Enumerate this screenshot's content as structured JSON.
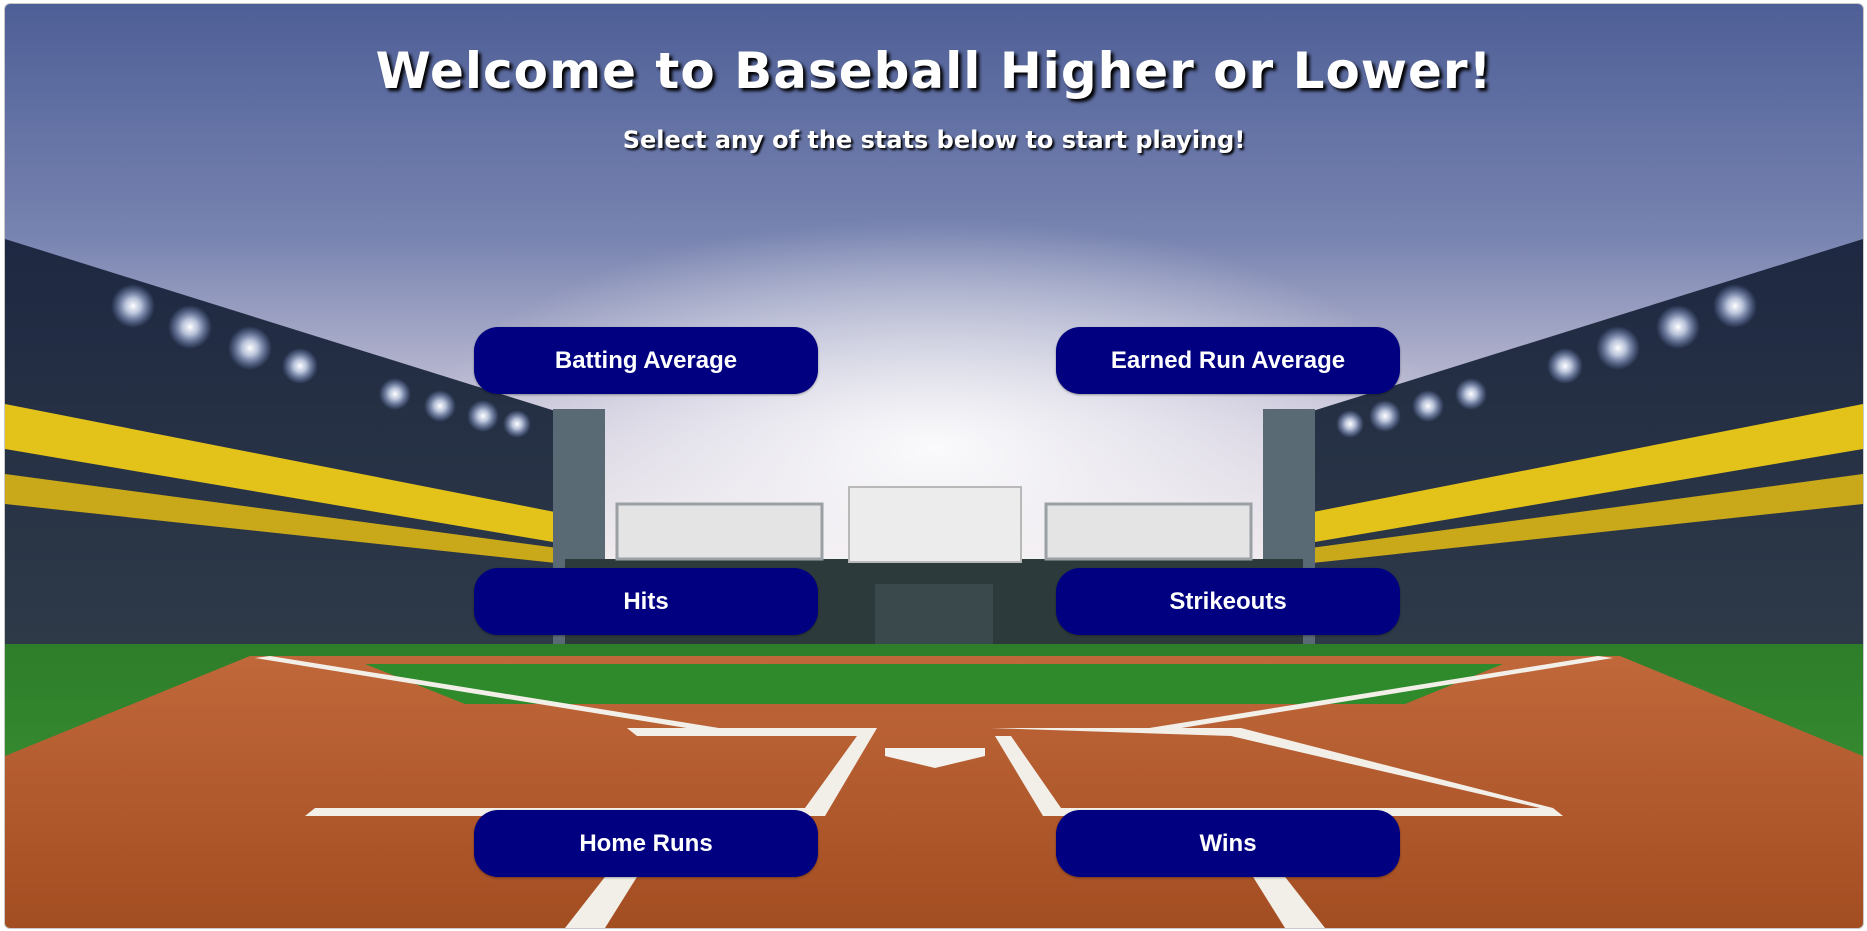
{
  "page": {
    "title": "Welcome to Baseball Higher or Lower!",
    "subtitle": "Select any of the stats below to start playing!"
  },
  "stats": {
    "batting_average": "Batting Average",
    "earned_run_average": "Earned Run Average",
    "hits": "Hits",
    "strikeouts": "Strikeouts",
    "home_runs": "Home Runs",
    "wins": "Wins"
  },
  "colors": {
    "button_background": "#000080",
    "button_text": "#ffffff",
    "title_text": "#ffffff",
    "infield_dirt": "#b55a2c",
    "grass": "#2f8a2a"
  }
}
